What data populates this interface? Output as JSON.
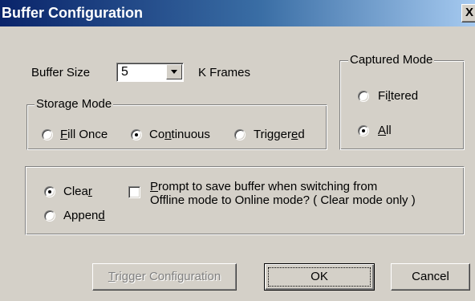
{
  "window": {
    "title": "Buffer Configuration",
    "close_glyph": "X"
  },
  "buffer": {
    "size_label": "Buffer Size",
    "size_value": "5",
    "units_label": "K Frames"
  },
  "storage_mode": {
    "legend": "Storage Mode",
    "options": [
      {
        "pre": "",
        "accel": "F",
        "post": "ill Once",
        "checked": false
      },
      {
        "pre": "Co",
        "accel": "n",
        "post": "tinuous",
        "checked": true
      },
      {
        "pre": "Trigger",
        "accel": "e",
        "post": "d",
        "checked": false
      }
    ]
  },
  "captured_mode": {
    "legend": "Captured Mode",
    "options": [
      {
        "pre": "Fi",
        "accel": "l",
        "post": "tered",
        "checked": false
      },
      {
        "pre": "",
        "accel": "A",
        "post": "ll",
        "checked": true
      }
    ]
  },
  "clear_append": {
    "options": [
      {
        "pre": "Clea",
        "accel": "r",
        "post": "",
        "checked": true
      },
      {
        "pre": "Appen",
        "accel": "d",
        "post": "",
        "checked": false
      }
    ]
  },
  "prompt_checkbox": {
    "checked": false,
    "line1_accel": "P",
    "line1_rest": "rompt to save buffer when switching from",
    "line2": "Offline mode to Online mode? ( Clear mode only )"
  },
  "buttons": {
    "trigger": {
      "accel": "T",
      "rest": "rigger Configuration",
      "enabled": false
    },
    "ok": "OK",
    "cancel": "Cancel"
  },
  "colors": {
    "face": "#d4d0c8",
    "title_start": "#0a246a",
    "title_end": "#a6caf0"
  }
}
